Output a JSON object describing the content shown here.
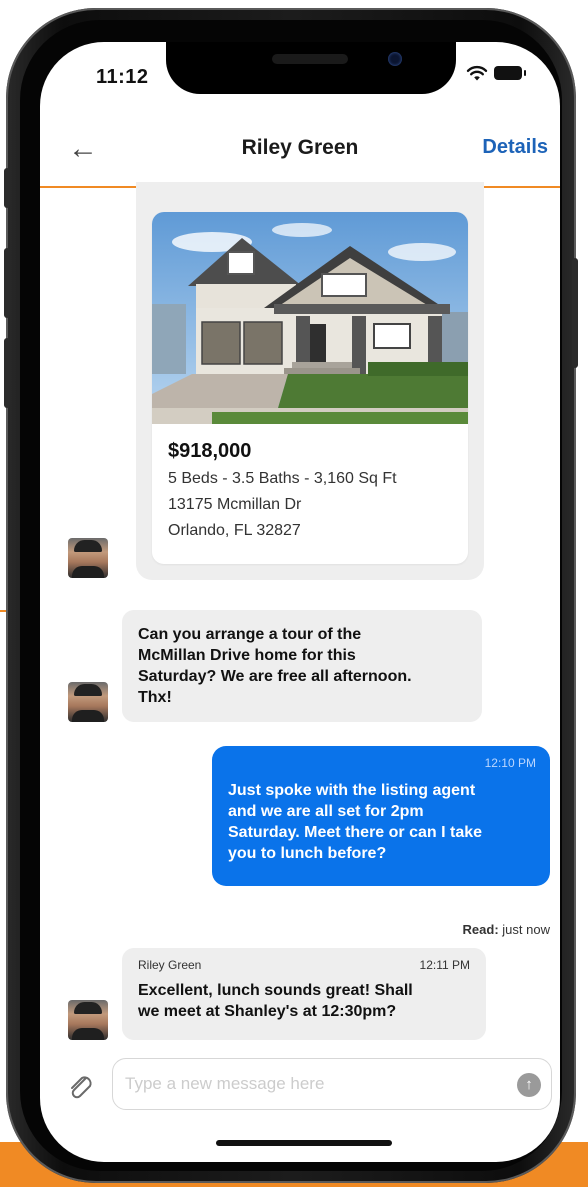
{
  "status_bar": {
    "time": "11:12"
  },
  "nav": {
    "back_icon": "back-arrow-icon",
    "title": "Riley Green",
    "details_label": "Details"
  },
  "listing": {
    "price": "$918,000",
    "specs": "5 Beds - 3.5 Baths - 3,160 Sq Ft",
    "address_line1": "13175 Mcmillan Dr",
    "address_line2": "Orlando, FL 32827"
  },
  "messages": [
    {
      "direction": "in",
      "text": [
        "Can you arrange a tour of the",
        "McMillan Drive home for this",
        "Saturday? We are free all afternoon.",
        "Thx!"
      ]
    },
    {
      "direction": "out",
      "time": "12:10 PM",
      "text": [
        "Just spoke with the listing agent",
        "and we are all set for 2pm",
        "Saturday. Meet there or can I take",
        "you to lunch before?"
      ]
    },
    {
      "direction": "in",
      "sender": "Riley Green",
      "time": "12:11 PM",
      "text": [
        "Excellent, lunch sounds great! Shall",
        "we meet at Shanley's at 12:30pm?"
      ]
    }
  ],
  "read_receipt": {
    "label": "Read:",
    "value": "just now"
  },
  "composer": {
    "placeholder": "Type a new message here",
    "attach_icon": "paperclip-icon",
    "send_icon": "send-arrow-icon"
  },
  "colors": {
    "accent": "#f08a24",
    "link": "#1d63b8",
    "outgoing_bubble": "#0a73ea",
    "incoming_bubble": "#eeeeee"
  }
}
